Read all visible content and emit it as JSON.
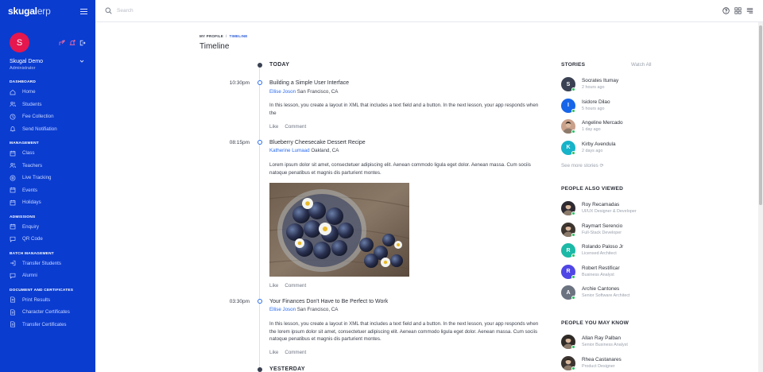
{
  "brand": {
    "name_bold": "skugal",
    "name_light": "erp"
  },
  "sidebar": {
    "avatar_letter": "S",
    "user_name": "Skugal Demo",
    "user_role": "Administrator",
    "sections": [
      {
        "title": "DASHBOARD",
        "items": [
          {
            "label": "Home",
            "icon": "home-icon"
          },
          {
            "label": "Students",
            "icon": "users-icon"
          },
          {
            "label": "Fee Collection",
            "icon": "clock-icon"
          },
          {
            "label": "Send Notifiation",
            "icon": "bell-icon"
          }
        ]
      },
      {
        "title": "MANAGEMENT",
        "items": [
          {
            "label": "Class",
            "icon": "calendar-icon"
          },
          {
            "label": "Teachers",
            "icon": "users-icon"
          },
          {
            "label": "Live Tracking",
            "icon": "location-icon"
          },
          {
            "label": "Events",
            "icon": "calendar-icon"
          },
          {
            "label": "Holidays",
            "icon": "calendar-icon"
          }
        ]
      },
      {
        "title": "ADMISSIONS",
        "items": [
          {
            "label": "Enquiry",
            "icon": "calendar-icon"
          },
          {
            "label": "QR Code",
            "icon": "chat-icon"
          }
        ]
      },
      {
        "title": "BATCH MANAGEMENT",
        "items": [
          {
            "label": "Transfer Students",
            "icon": "login-icon"
          },
          {
            "label": "Alumni",
            "icon": "chat-icon"
          }
        ]
      },
      {
        "title": "DOCUMENT AND CERTIFICATES",
        "items": [
          {
            "label": "Print Results",
            "icon": "document-icon"
          },
          {
            "label": "Character Certificates",
            "icon": "document-icon"
          },
          {
            "label": "Transfer Certificates",
            "icon": "document-icon"
          }
        ]
      }
    ]
  },
  "search": {
    "placeholder": "Search"
  },
  "breadcrumb": {
    "home": "MY PROFILE",
    "separator": "/",
    "current": "TIMELINE"
  },
  "page_title": "Timeline",
  "timeline": {
    "day_today": "TODAY",
    "day_yesterday": "YESTERDAY",
    "like_label": "Like",
    "comment_label": "Comment",
    "events": [
      {
        "time": "10:30pm",
        "title": "Building a Simple User Interface",
        "author": "Ellise Joson",
        "location": "San Francisco, CA",
        "body": "In this lesson, you create a layout in XML that includes a text field and a button. In the next lesson, your app responds when the"
      },
      {
        "time": "08:15pm",
        "title": "Blueberry Cheesecake Dessert Recipe",
        "author": "Katherine Lumaad",
        "location": "Oakland, CA",
        "body": "Lorem ipsum dolor sit amet, consectetuer adipiscing elit. Aenean commodo ligula eget dolor. Aenean massa. Cum sociis natoque penatibus et magnis dis parturient montes."
      },
      {
        "time": "03:30pm",
        "title": "Your Finances Don't Have to Be Perfect to Work",
        "author": "Ellise Joson",
        "location": "San Francisco, CA",
        "body": "In this lesson, you create a layout in XML that includes a text field and a button. In the next lesson, your app responds when the lorem ipsum dolor sit amet, consectetuer adipiscing elit. Aenean commodo ligula eget dolor. Aenean massa. Cum sociis natoque penatibus et magnis dis parturient montes."
      }
    ]
  },
  "stories": {
    "title": "STORIES",
    "watch_all": "Watch All",
    "see_more": "See more stories",
    "items": [
      {
        "initial": "S",
        "name": "Socrates Itumay",
        "time": "2 hours ago",
        "color": "#3a4152"
      },
      {
        "initial": "I",
        "name": "Isidore Dilao",
        "time": "5 hours ago",
        "color": "#1765e8"
      },
      {
        "initial": "",
        "name": "Angeline Mercado",
        "time": "1 day ago",
        "color": "#c9a08a"
      },
      {
        "initial": "K",
        "name": "Kirby Avendula",
        "time": "2 days ago",
        "color": "#17b3c9"
      }
    ]
  },
  "also_viewed": {
    "title": "PEOPLE ALSO VIEWED",
    "items": [
      {
        "initial": "",
        "name": "Roy Recamadas",
        "role": "UI/UX Designer & Developer",
        "color": "#2d2a33"
      },
      {
        "initial": "",
        "name": "Raymart Serencio",
        "role": "Full-Stack Developer",
        "color": "#3c3530"
      },
      {
        "initial": "R",
        "name": "Rolando Paloso Jr",
        "role": "Licensed Architect",
        "color": "#1bb9a6"
      },
      {
        "initial": "R",
        "name": "Robert Restificar",
        "role": "Business Analyst",
        "color": "#4f46e5"
      },
      {
        "initial": "A",
        "name": "Archie Cantones",
        "role": "Senior Software Architect",
        "color": "#6b7280"
      }
    ]
  },
  "may_know": {
    "title": "PEOPLE YOU MAY KNOW",
    "items": [
      {
        "initial": "",
        "name": "Allan Ray Palban",
        "role": "Senior Business Analyst",
        "color": "#2f2b27"
      },
      {
        "initial": "",
        "name": "Rhea Castanares",
        "role": "Product Designer",
        "color": "#3b3431"
      }
    ]
  }
}
